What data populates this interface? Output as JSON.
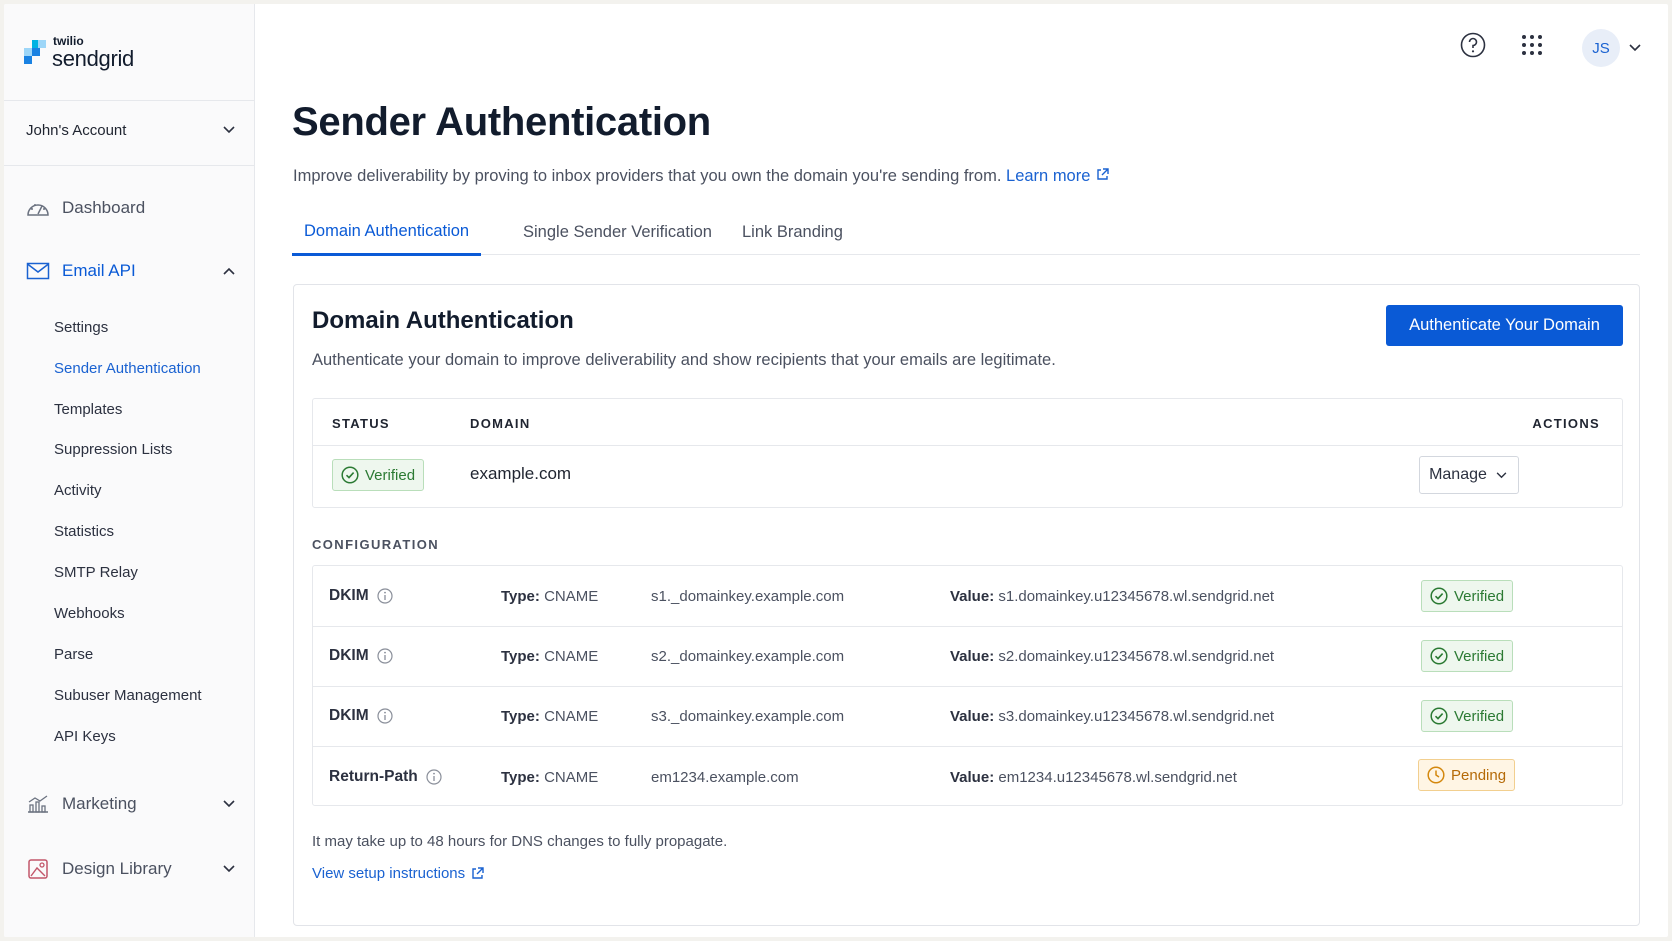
{
  "brand": {
    "small": "twilio",
    "big": "sendgrid"
  },
  "sidebar": {
    "account": "John's Account",
    "dashboard": "Dashboard",
    "email_api": "Email API",
    "sub_items": [
      "Settings",
      "Sender Authentication",
      "Templates",
      "Suppression Lists",
      "Activity",
      "Statistics",
      "SMTP Relay",
      "Webhooks",
      "Parse",
      "Subuser Management",
      "API Keys"
    ],
    "current_sub": "Sender Authentication",
    "marketing": "Marketing",
    "design_library": "Design Library"
  },
  "topbar": {
    "help_icon": "question-circle-icon",
    "apps_icon": "grid-icon",
    "avatar_initials": "JS"
  },
  "page": {
    "title": "Sender Authentication",
    "description": "Improve deliverability by proving to inbox providers that you own the domain you're sending from.",
    "learn_more": "Learn more"
  },
  "tabs": [
    {
      "label": "Domain Authentication",
      "active": true
    },
    {
      "label": "Single Sender Verification",
      "active": false
    },
    {
      "label": "Link Branding",
      "active": false
    }
  ],
  "card": {
    "title": "Domain Authentication",
    "description": "Authenticate your domain to improve deliverability and show recipients that your emails are legitimate.",
    "primary_button": "Authenticate Your Domain",
    "table_headers": {
      "status": "STATUS",
      "domain": "DOMAIN",
      "actions": "ACTIONS"
    },
    "domain_row": {
      "status": "Verified",
      "domain": "example.com",
      "action": "Manage"
    },
    "config_label": "CONFIGURATION",
    "type_label": "Type:",
    "value_label": "Value:",
    "config_rows": [
      {
        "record": "DKIM",
        "type": "CNAME",
        "host": "s1._domainkey.example.com",
        "value": "s1.domainkey.u12345678.wl.sendgrid.net",
        "status": "Verified"
      },
      {
        "record": "DKIM",
        "type": "CNAME",
        "host": "s2._domainkey.example.com",
        "value": "s2.domainkey.u12345678.wl.sendgrid.net",
        "status": "Verified"
      },
      {
        "record": "DKIM",
        "type": "CNAME",
        "host": "s3._domainkey.example.com",
        "value": "s3.domainkey.u12345678.wl.sendgrid.net",
        "status": "Verified"
      },
      {
        "record": "Return-Path",
        "type": "CNAME",
        "host": "em1234.example.com",
        "value": "em1234.u12345678.wl.sendgrid.net",
        "status": "Pending"
      }
    ],
    "footnote": "It may take up to 48 hours for DNS changes to fully propagate.",
    "setup_link": "View setup instructions"
  },
  "colors": {
    "accent": "#0a5ad6",
    "verified": "#2b7a33",
    "pending": "#b56a07"
  }
}
